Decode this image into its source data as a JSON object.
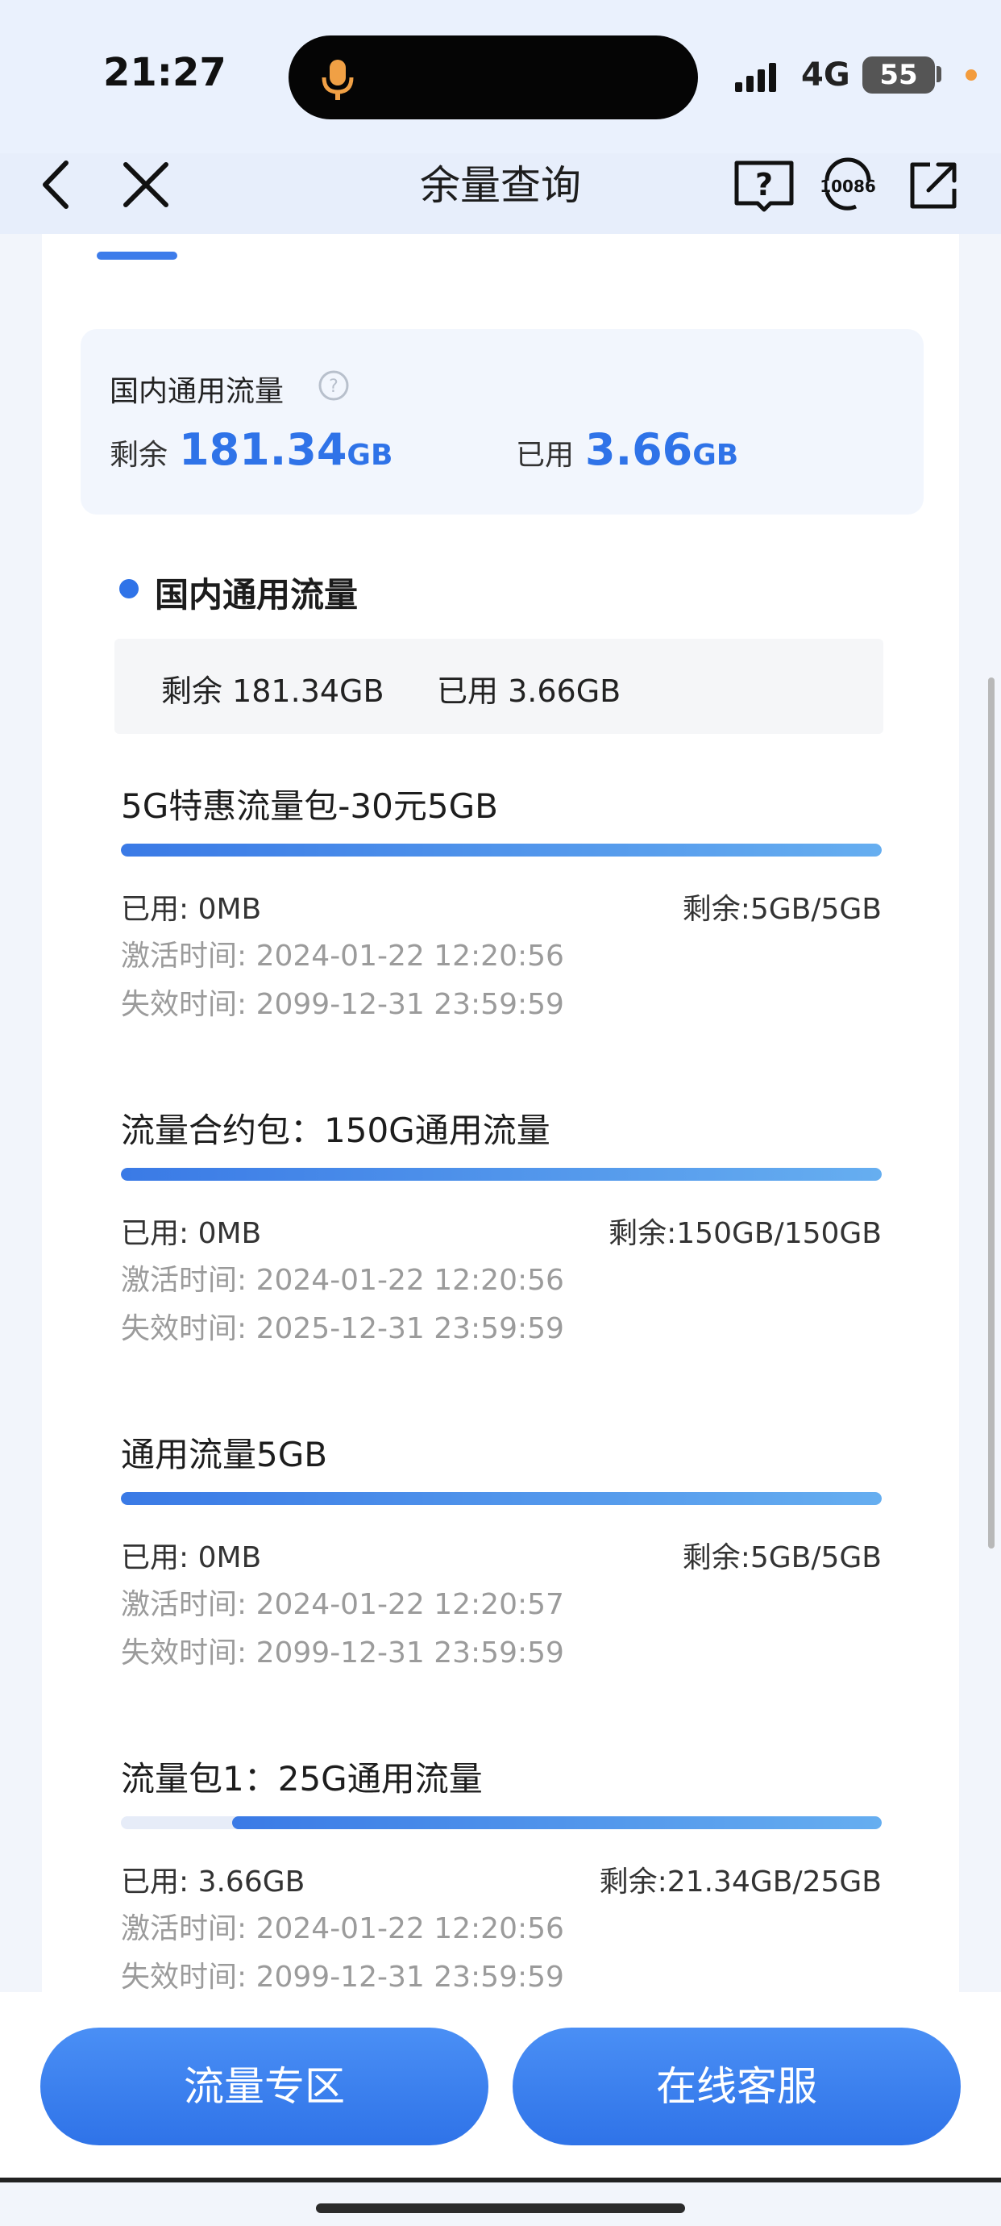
{
  "status_bar": {
    "time": "21:27",
    "network": "4G",
    "battery": "55",
    "icons": [
      "mic-icon",
      "signal-icon",
      "battery-icon"
    ]
  },
  "nav": {
    "title": "余量查询",
    "back_icon": "chevron-left-icon",
    "close_icon": "close-icon",
    "help_icon": "help-book-icon",
    "service_icon": "10086-service-icon",
    "service_label": "10086",
    "share_icon": "share-icon"
  },
  "summary": {
    "title": "国内通用流量",
    "remain_label": "剩余",
    "remain_value": "181.34",
    "remain_unit": "GB",
    "used_label": "已用",
    "used_value": "3.66",
    "used_unit": "GB"
  },
  "section": {
    "title": "国内通用流量",
    "remain_text": "剩余 181.34GB",
    "used_text": "已用 3.66GB"
  },
  "packages": [
    {
      "name": "5G特惠流量包-30元5GB",
      "used": "已用: 0MB",
      "remain": "剩余:5GB/5GB",
      "remain_fraction": 1.0,
      "activated": "激活时间: 2024-01-22 12:20:56",
      "expires": "失效时间: 2099-12-31 23:59:59"
    },
    {
      "name": "流量合约包：150G通用流量",
      "used": "已用: 0MB",
      "remain": "剩余:150GB/150GB",
      "remain_fraction": 1.0,
      "activated": "激活时间: 2024-01-22 12:20:56",
      "expires": "失效时间: 2025-12-31 23:59:59"
    },
    {
      "name": "通用流量5GB",
      "used": "已用: 0MB",
      "remain": "剩余:5GB/5GB",
      "remain_fraction": 1.0,
      "activated": "激活时间: 2024-01-22 12:20:57",
      "expires": "失效时间: 2099-12-31 23:59:59"
    },
    {
      "name": "流量包1：25G通用流量",
      "used": "已用: 3.66GB",
      "remain": "剩余:21.34GB/25GB",
      "remain_fraction": 0.8536,
      "activated": "激活时间: 2024-01-22 12:20:56",
      "expires": "失效时间: 2099-12-31 23:59:59"
    }
  ],
  "bottom": {
    "left_button": "流量专区",
    "right_button": "在线客服"
  },
  "colors": {
    "accent": "#2f73e8",
    "header_bg": "#eaf1fd",
    "muted_text": "#9b9b9b"
  }
}
